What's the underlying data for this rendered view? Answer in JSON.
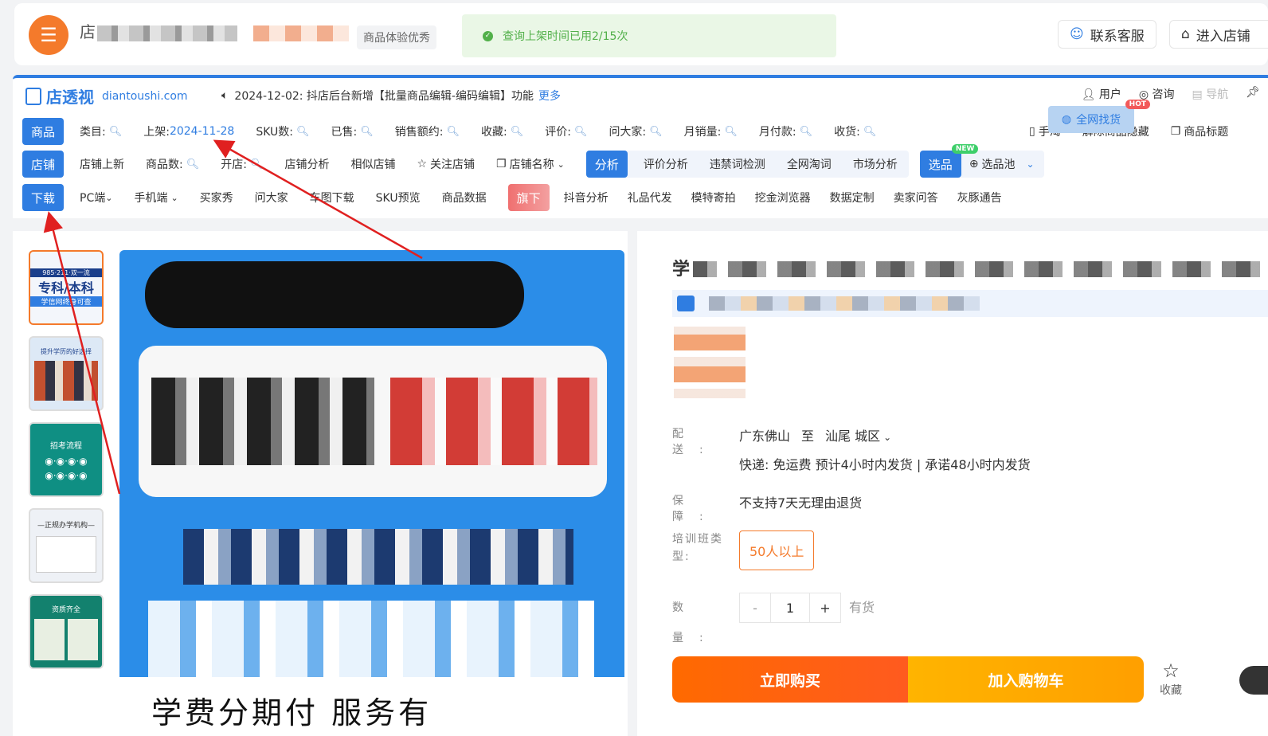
{
  "header": {
    "logo_glyph": "☰",
    "shop_name_first_char": "店",
    "experience_tag": "商品体验优秀",
    "toast_text": "查询上架时间已用2/15次",
    "contact_label": "联系客服",
    "enter_label": "进入店铺"
  },
  "plugin": {
    "brand_name": "店透视",
    "brand_domain": "diantoushi.com",
    "notice": "2024-12-02: 抖店后台新增【批量商品编辑-编码编辑】功能",
    "notice_more": "更多",
    "right_links": {
      "user": "用户",
      "consult": "咨询",
      "nav": "导航"
    },
    "row1": {
      "label": "商品",
      "items": [
        "类目:",
        "上架:",
        "SKU数:",
        "已售:",
        "销售额约:",
        "收藏:",
        "评价:",
        "问大家:",
        "月销量:",
        "月付款:",
        "收货:"
      ],
      "listed_date": "2024-11-28",
      "right": [
        "手淘",
        "解除商品隐藏",
        "商品标题"
      ]
    },
    "row2": {
      "label": "店铺",
      "items": [
        "店铺上新",
        "商品数:",
        "开店:",
        "店铺分析",
        "相似店铺",
        "关注店铺",
        "店铺名称"
      ],
      "analysis_label": "分析",
      "analysis_items": [
        "评价分析",
        "违禁词检测",
        "全网淘词",
        "市场分析"
      ],
      "select_label": "选品",
      "select_badge": "NEW",
      "select_pool": "选品池"
    },
    "row3": {
      "label": "下载",
      "items": [
        "PC端",
        "手机端",
        "买家秀",
        "问大家",
        "车图下载",
        "SKU预览",
        "商品数据"
      ],
      "flag_label": "旗下",
      "flag_items": [
        "抖音分析",
        "礼品代发",
        "模特寄拍",
        "挖金浏览器",
        "数据定制",
        "卖家问答",
        "灰豚通告"
      ],
      "find_goods": "全网找货",
      "find_badge": "HOT"
    }
  },
  "gallery": {
    "thumbs": [
      {
        "line1": "985·211·双一流",
        "line2": "专科/本科",
        "line3": "学信网终身可查"
      },
      {
        "line1": "提升学历的好选择",
        "line2": "",
        "line3": ""
      },
      {
        "line1": "招考流程",
        "line2": "",
        "line3": ""
      },
      {
        "line1": "—正规办学机构—",
        "line2": "",
        "line3": ""
      },
      {
        "line1": "资质齐全",
        "line2": "",
        "line3": ""
      }
    ],
    "main_bottom_text": "学费分期付  服务有"
  },
  "product": {
    "title_first_char": "学",
    "delivery_label": "配送:",
    "delivery_from": "广东佛山",
    "delivery_to_word": "至",
    "delivery_to": "汕尾 城区",
    "shipping": "快递: 免运费  预计4小时内发货 | 承诺48小时内发货",
    "guarantee_label": "保障:",
    "guarantee": "不支持7天无理由退货",
    "class_label": "培训班类型:",
    "class_option": "50人以上",
    "qty_label": "数量:",
    "qty_minus": "-",
    "qty_value": "1",
    "qty_plus": "+",
    "stock": "有货",
    "buy_now": "立即购买",
    "add_cart": "加入购物车",
    "favorite": "收藏"
  },
  "colors": {
    "accent_blue": "#2f7de1",
    "brand_orange": "#f47a2b",
    "success_green": "#52b04a",
    "annotation_red": "#e02020"
  }
}
